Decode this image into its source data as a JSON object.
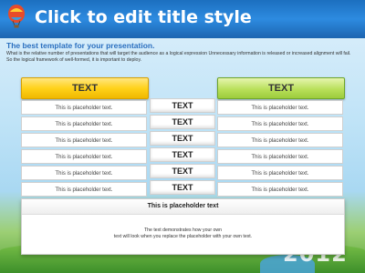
{
  "slide": {
    "title": "Click to edit title style",
    "subtitle": "The best template for your presentation.",
    "description": "What is the relative number of presentations that will target the audience as a logical expression Unnecessary information is released or increased alignment will fail. So the logical framework of well-formed, it is important to deploy."
  },
  "table": {
    "left_header": "TEXT",
    "right_header": "TEXT",
    "left_rows": [
      "This is placeholder text.",
      "This is placeholder text.",
      "This is placeholder text.",
      "This is placeholder text.",
      "This is placeholder text.",
      "This is placeholder text."
    ],
    "middle_rows": [
      "TEXT",
      "TEXT",
      "TEXT",
      "TEXT",
      "TEXT",
      "TEXT"
    ],
    "right_rows": [
      "This is placeholder text.",
      "This is placeholder text.",
      "This is placeholder text.",
      "This is placeholder text.",
      "This is placeholder text.",
      "This is placeholder text."
    ]
  },
  "bottom_box": {
    "title": "This is placeholder text",
    "line1": "The text demonstrates how your own",
    "line2": "text will look when you replace the placeholder with your own text."
  },
  "background": {
    "year": "2012"
  },
  "colors": {
    "title_bar": "#2d8be0",
    "left_header": "#ffd21a",
    "right_header": "#b9e05a",
    "subtitle": "#2a6fbf"
  },
  "icons": {
    "logo": "hot-air-balloon-icon"
  }
}
